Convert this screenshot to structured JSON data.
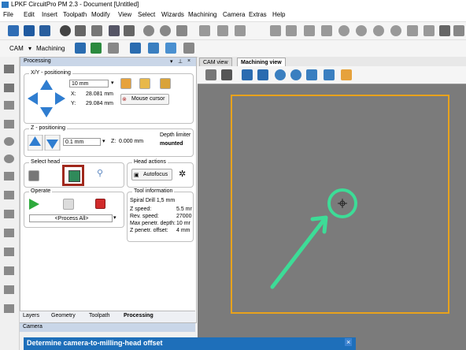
{
  "window": {
    "title": "LPKF CircuitPro PM 2.3 - Document [Untitled]"
  },
  "menu": [
    "File",
    "Edit",
    "Insert",
    "Toolpath",
    "Modify",
    "View",
    "Select",
    "Wizards",
    "Machining",
    "Camera",
    "Extras",
    "Help"
  ],
  "toolbar2": {
    "mode1": "CAM",
    "mode2": "Machining"
  },
  "processing": {
    "title": "Processing",
    "xy_title": "X/Y - positioning",
    "step_value": "10 mm",
    "x_label": "X:",
    "x_value": "28.081 mm",
    "y_label": "Y:",
    "y_value": "29.084 mm",
    "mouse_cursor": "Mouse cursor",
    "z_title": "Z - positioning",
    "z_step": "0.1 mm",
    "z_label": "Z:",
    "z_value": "0.000 mm",
    "depth_limiter": "Depth limiter",
    "depth_state": "mounted",
    "select_head": "Select head",
    "head_actions": "Head actions",
    "autofocus": "Autofocus",
    "operate": "Operate",
    "process_select": "<Process All>",
    "tool_info": "Tool information",
    "tool_name": "Spiral Drill 1,5 mm",
    "tool_rows": [
      {
        "label": "Z speed:",
        "value": "5.5 mr"
      },
      {
        "label": "Rev. speed:",
        "value": "27000"
      },
      {
        "label": "Max penetr. depth:",
        "value": "10 mr"
      },
      {
        "label": "Z penetr. offset:",
        "value": "4 mm"
      }
    ]
  },
  "bottom_tabs": [
    "Layers",
    "Geometry",
    "Toolpath",
    "Processing"
  ],
  "camera_panel": "Camera",
  "dialog": {
    "title": "Determine camera-to-milling-head offset"
  },
  "view_tabs": [
    "CAM view",
    "Machining view"
  ],
  "colors": {
    "board_outline": "#e8a21c",
    "highlight_box": "#a0281c",
    "annotation": "#3ddc97"
  }
}
